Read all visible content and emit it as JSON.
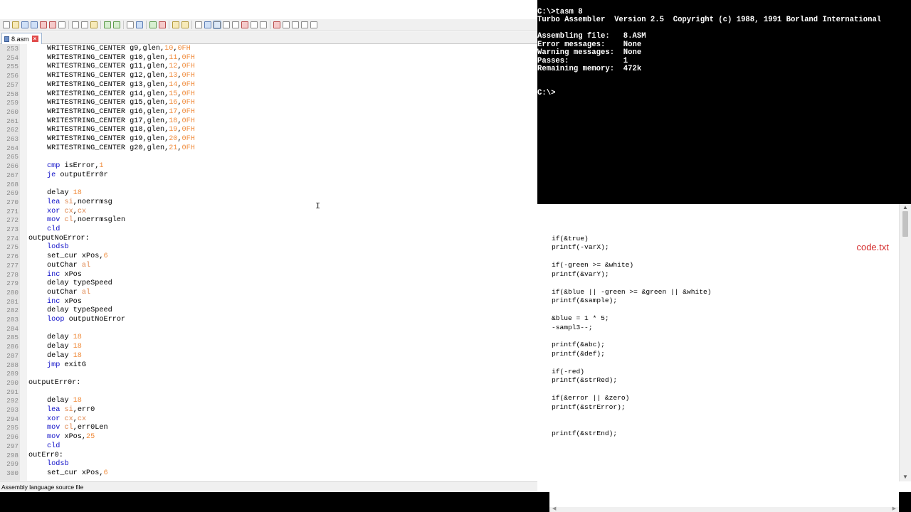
{
  "editor": {
    "tab_label": "8.asm",
    "status_text": "Assembly language source file",
    "lines": [
      {
        "n": "253",
        "t": [
          [
            "WRITESTRING_CENTER g9,glen,",
            "def"
          ],
          [
            "10",
            "num"
          ],
          [
            ",",
            "def"
          ],
          [
            "0FH",
            "num"
          ]
        ]
      },
      {
        "n": "254",
        "t": [
          [
            "WRITESTRING_CENTER g10,glen,",
            "def"
          ],
          [
            "11",
            "num"
          ],
          [
            ",",
            "def"
          ],
          [
            "0FH",
            "num"
          ]
        ]
      },
      {
        "n": "255",
        "t": [
          [
            "WRITESTRING_CENTER g11,glen,",
            "def"
          ],
          [
            "12",
            "num"
          ],
          [
            ",",
            "def"
          ],
          [
            "0FH",
            "num"
          ]
        ]
      },
      {
        "n": "256",
        "t": [
          [
            "WRITESTRING_CENTER g12,glen,",
            "def"
          ],
          [
            "13",
            "num"
          ],
          [
            ",",
            "def"
          ],
          [
            "0FH",
            "num"
          ]
        ]
      },
      {
        "n": "257",
        "t": [
          [
            "WRITESTRING_CENTER g13,glen,",
            "def"
          ],
          [
            "14",
            "num"
          ],
          [
            ",",
            "def"
          ],
          [
            "0FH",
            "num"
          ]
        ]
      },
      {
        "n": "258",
        "t": [
          [
            "WRITESTRING_CENTER g14,glen,",
            "def"
          ],
          [
            "15",
            "num"
          ],
          [
            ",",
            "def"
          ],
          [
            "0FH",
            "num"
          ]
        ]
      },
      {
        "n": "259",
        "t": [
          [
            "WRITESTRING_CENTER g15,glen,",
            "def"
          ],
          [
            "16",
            "num"
          ],
          [
            ",",
            "def"
          ],
          [
            "0FH",
            "num"
          ]
        ]
      },
      {
        "n": "260",
        "t": [
          [
            "WRITESTRING_CENTER g16,glen,",
            "def"
          ],
          [
            "17",
            "num"
          ],
          [
            ",",
            "def"
          ],
          [
            "0FH",
            "num"
          ]
        ]
      },
      {
        "n": "261",
        "t": [
          [
            "WRITESTRING_CENTER g17,glen,",
            "def"
          ],
          [
            "18",
            "num"
          ],
          [
            ",",
            "def"
          ],
          [
            "0FH",
            "num"
          ]
        ]
      },
      {
        "n": "262",
        "t": [
          [
            "WRITESTRING_CENTER g18,glen,",
            "def"
          ],
          [
            "19",
            "num"
          ],
          [
            ",",
            "def"
          ],
          [
            "0FH",
            "num"
          ]
        ]
      },
      {
        "n": "263",
        "t": [
          [
            "WRITESTRING_CENTER g19,glen,",
            "def"
          ],
          [
            "20",
            "num"
          ],
          [
            ",",
            "def"
          ],
          [
            "0FH",
            "num"
          ]
        ]
      },
      {
        "n": "264",
        "t": [
          [
            "WRITESTRING_CENTER g20,glen,",
            "def"
          ],
          [
            "21",
            "num"
          ],
          [
            ",",
            "def"
          ],
          [
            "0FH",
            "num"
          ]
        ]
      },
      {
        "n": "265",
        "t": []
      },
      {
        "n": "266",
        "t": [
          [
            "cmp",
            "kw"
          ],
          [
            " isError,",
            "def"
          ],
          [
            "1",
            "num"
          ]
        ]
      },
      {
        "n": "267",
        "t": [
          [
            "je",
            "kw"
          ],
          [
            " outputErr0r",
            "def"
          ]
        ]
      },
      {
        "n": "268",
        "t": []
      },
      {
        "n": "269",
        "t": [
          [
            "delay ",
            "def"
          ],
          [
            "18",
            "num"
          ]
        ]
      },
      {
        "n": "270",
        "t": [
          [
            "lea",
            "kw"
          ],
          [
            " ",
            "def"
          ],
          [
            "si",
            "reg"
          ],
          [
            ",noerrmsg",
            "def"
          ]
        ]
      },
      {
        "n": "271",
        "t": [
          [
            "xor",
            "kw"
          ],
          [
            " ",
            "def"
          ],
          [
            "cx",
            "reg"
          ],
          [
            ",",
            "def"
          ],
          [
            "cx",
            "reg"
          ]
        ]
      },
      {
        "n": "272",
        "t": [
          [
            "mov",
            "kw"
          ],
          [
            " ",
            "def"
          ],
          [
            "cl",
            "reg"
          ],
          [
            ",noerrmsglen",
            "def"
          ]
        ]
      },
      {
        "n": "273",
        "t": [
          [
            "cld",
            "kw"
          ]
        ]
      },
      {
        "n": "274",
        "label": true,
        "t": [
          [
            "outputNoError:",
            "def"
          ]
        ]
      },
      {
        "n": "275",
        "t": [
          [
            "lodsb",
            "kw"
          ]
        ]
      },
      {
        "n": "276",
        "t": [
          [
            "set_cur xPos,",
            "def"
          ],
          [
            "6",
            "num"
          ]
        ]
      },
      {
        "n": "277",
        "t": [
          [
            "outChar ",
            "def"
          ],
          [
            "al",
            "reg"
          ]
        ]
      },
      {
        "n": "278",
        "t": [
          [
            "inc",
            "kw"
          ],
          [
            " xPos",
            "def"
          ]
        ]
      },
      {
        "n": "279",
        "t": [
          [
            "delay typeSpeed",
            "def"
          ]
        ]
      },
      {
        "n": "280",
        "t": [
          [
            "outChar ",
            "def"
          ],
          [
            "al",
            "reg"
          ]
        ]
      },
      {
        "n": "281",
        "t": [
          [
            "inc",
            "kw"
          ],
          [
            " xPos",
            "def"
          ]
        ]
      },
      {
        "n": "282",
        "t": [
          [
            "delay typeSpeed",
            "def"
          ]
        ]
      },
      {
        "n": "283",
        "t": [
          [
            "loop",
            "kw"
          ],
          [
            " outputNoError",
            "def"
          ]
        ]
      },
      {
        "n": "284",
        "t": []
      },
      {
        "n": "285",
        "t": [
          [
            "delay ",
            "def"
          ],
          [
            "18",
            "num"
          ]
        ]
      },
      {
        "n": "286",
        "t": [
          [
            "delay ",
            "def"
          ],
          [
            "18",
            "num"
          ]
        ]
      },
      {
        "n": "287",
        "t": [
          [
            "delay ",
            "def"
          ],
          [
            "18",
            "num"
          ]
        ]
      },
      {
        "n": "288",
        "t": [
          [
            "jmp",
            "kw"
          ],
          [
            " exitG",
            "def"
          ]
        ]
      },
      {
        "n": "289",
        "t": []
      },
      {
        "n": "290",
        "label": true,
        "t": [
          [
            "outputErr0r:",
            "def"
          ]
        ]
      },
      {
        "n": "291",
        "t": []
      },
      {
        "n": "292",
        "t": [
          [
            "delay ",
            "def"
          ],
          [
            "18",
            "num"
          ]
        ]
      },
      {
        "n": "293",
        "t": [
          [
            "lea",
            "kw"
          ],
          [
            " ",
            "def"
          ],
          [
            "si",
            "reg"
          ],
          [
            ",err0",
            "def"
          ]
        ]
      },
      {
        "n": "294",
        "t": [
          [
            "xor",
            "kw"
          ],
          [
            " ",
            "def"
          ],
          [
            "cx",
            "reg"
          ],
          [
            ",",
            "def"
          ],
          [
            "cx",
            "reg"
          ]
        ]
      },
      {
        "n": "295",
        "t": [
          [
            "mov",
            "kw"
          ],
          [
            " ",
            "def"
          ],
          [
            "cl",
            "reg"
          ],
          [
            ",err0Len",
            "def"
          ]
        ]
      },
      {
        "n": "296",
        "t": [
          [
            "mov",
            "kw"
          ],
          [
            " xPos,",
            "def"
          ],
          [
            "25",
            "num"
          ]
        ]
      },
      {
        "n": "297",
        "t": [
          [
            "cld",
            "kw"
          ]
        ]
      },
      {
        "n": "298",
        "label": true,
        "t": [
          [
            "outErr0:",
            "def"
          ]
        ]
      },
      {
        "n": "299",
        "t": [
          [
            "lodsb",
            "kw"
          ]
        ]
      },
      {
        "n": "300",
        "t": [
          [
            "set_cur xPos,",
            "def"
          ],
          [
            "6",
            "num"
          ]
        ]
      }
    ]
  },
  "terminal": {
    "lines": [
      "C:\\>tasm 8",
      "Turbo Assembler  Version 2.5  Copyright (c) 1988, 1991 Borland International",
      "",
      "Assembling file:   8.ASM",
      "Error messages:    None",
      "Warning messages:  None",
      "Passes:            1",
      "Remaining memory:  472k",
      "",
      "C:\\>"
    ]
  },
  "viewer": {
    "title": "code.txt",
    "lines": [
      "if(&true)",
      "printf(-varX);",
      "",
      "if(-green >= &white)",
      "printf(&varY);",
      "",
      "if(&blue || -green >= &green || &white)",
      "printf(&sample);",
      "",
      "&blue = 1 * 5;",
      "-sampl3--;",
      "",
      "printf(&abc);",
      "printf(&def);",
      "",
      "if(-red)",
      "printf(&strRed);",
      "",
      "if(&error || &zero)",
      "printf(&strError);",
      "",
      "",
      "printf(&strEnd);"
    ]
  },
  "colors": {
    "keyword": "#1010c8",
    "number": "#f08c3c",
    "viewer_title": "#d42b2b"
  }
}
